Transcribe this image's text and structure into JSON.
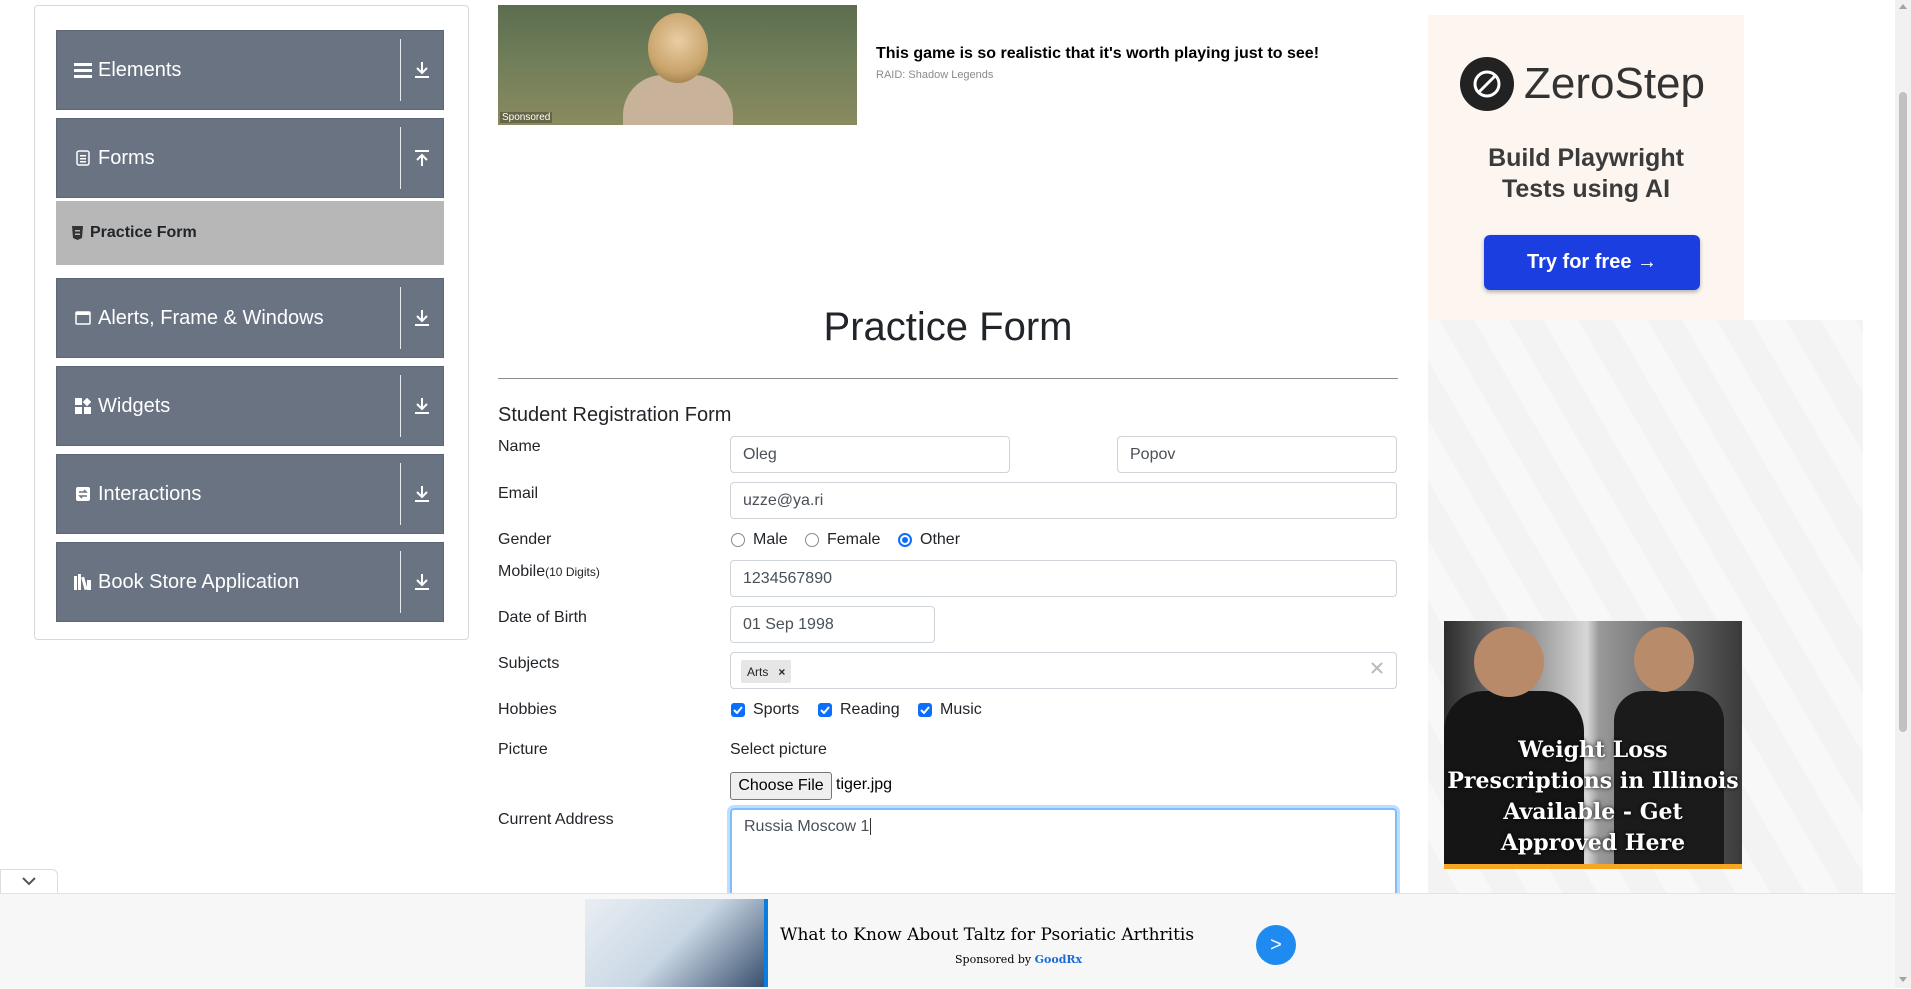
{
  "sidebar": {
    "groups": [
      {
        "label": "Elements",
        "icon": "menu-lines-icon",
        "arrow": "download-arrow-icon"
      },
      {
        "label": "Forms",
        "icon": "document-icon",
        "arrow": "upload-arrow-icon"
      },
      {
        "label": "Alerts, Frame & Windows",
        "icon": "window-icon",
        "arrow": "download-arrow-icon"
      },
      {
        "label": "Widgets",
        "icon": "widgets-icon",
        "arrow": "download-arrow-icon"
      },
      {
        "label": "Interactions",
        "icon": "interactions-icon",
        "arrow": "download-arrow-icon"
      },
      {
        "label": "Book Store Application",
        "icon": "books-icon",
        "arrow": "download-arrow-icon"
      }
    ],
    "active_item": {
      "label": "Practice Form",
      "icon": "html5-icon"
    }
  },
  "top_ad": {
    "title": "This game is so realistic that it's worth playing just to see!",
    "source": "RAID: Shadow Legends",
    "sponsored": "Sponsored"
  },
  "form": {
    "page_title": "Practice Form",
    "subtitle": "Student Registration Form",
    "labels": {
      "name": "Name",
      "email": "Email",
      "gender": "Gender",
      "mobile": "Mobile",
      "mobile_hint": "(10 Digits)",
      "dob": "Date of Birth",
      "subjects": "Subjects",
      "hobbies": "Hobbies",
      "picture": "Picture",
      "address": "Current Address"
    },
    "first_name": "Oleg",
    "last_name": "Popov",
    "email": "uzze@ya.ri",
    "gender_options": [
      "Male",
      "Female",
      "Other"
    ],
    "gender_selected": "Other",
    "mobile": "1234567890",
    "dob": "01 Sep 1998",
    "subjects": [
      "Arts"
    ],
    "hobbies": [
      "Sports",
      "Reading",
      "Music"
    ],
    "picture": {
      "prompt": "Select picture",
      "button": "Choose File",
      "filename": "tiger.jpg"
    },
    "address": "Russia Moscow 1"
  },
  "zerostep_ad": {
    "brand": "ZeroStep",
    "tagline_line1": "Build Playwright",
    "tagline_line2": "Tests using AI",
    "button": "Try for free →",
    "accent": "#1b3ee0"
  },
  "weightloss_ad": {
    "text": "Weight Loss Prescriptions in Illinois Available - Get Approved Here"
  },
  "bottom_ad": {
    "title": "What to Know About Taltz for Psoriatic Arthritis",
    "sponsored_prefix": "Sponsored by",
    "sponsor": "GoodRx",
    "go": ">"
  },
  "colors": {
    "sidebar_group": "#697382",
    "sidebar_active": "#b7b7b7",
    "primary": "#0b6efd"
  }
}
